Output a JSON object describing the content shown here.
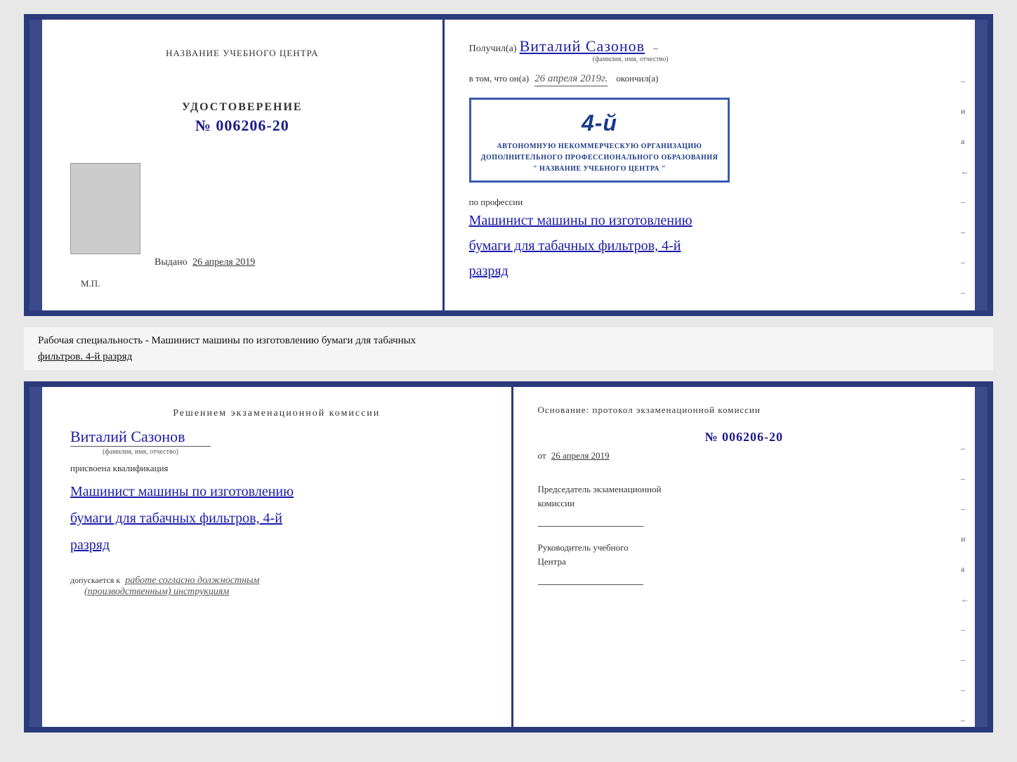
{
  "top_cert": {
    "left": {
      "org_name_label": "НАЗВАНИЕ УЧЕБНОГО ЦЕНТРА",
      "udost_label": "УДОСТОВЕРЕНИЕ",
      "udost_number": "№ 006206-20",
      "vydano_prefix": "Выдано",
      "vydano_date": "26 апреля 2019",
      "mp_label": "М.П."
    },
    "right": {
      "poluchil_prefix": "Получил(а)",
      "name_handwritten": "Виталий Сазонов",
      "name_subtext": "(фамилия, имя, отчество)",
      "dash1": "–",
      "vtom_prefix": "в том, что он(а)",
      "vtom_date": "26 апреля 2019г.",
      "okonchil_label": "окончил(а)",
      "stamp_number": "4-й",
      "stamp_line1": "АВТОНОМНУЮ НЕКОММЕРЧЕСКУЮ ОРГАНИЗАЦИЮ",
      "stamp_line2": "ДОПОЛНИТЕЛЬНОГО ПРОФЕССИОНАЛЬНОГО ОБРАЗОВАНИЯ",
      "stamp_line3": "\" НАЗВАНИЕ УЧЕБНОГО ЦЕНТРА \"",
      "i_label": "и",
      "a_label": "а",
      "arrow_label": "←",
      "po_professii_label": "по профессии",
      "profession_line1": "Машинист машины по изготовлению",
      "profession_line2": "бумаги для табачных фильтров, 4-й",
      "profession_line3": "разряд"
    }
  },
  "label_section": {
    "text_prefix": "Рабочая специальность - Машинист машины по изготовлению бумаги для табачных",
    "text_underlined": "фильтров. 4-й разряд"
  },
  "bottom_cert": {
    "left": {
      "resheniem_label": "Решением  экзаменационной  комиссии",
      "name_handwritten": "Виталий Сазонов",
      "fio_subtext": "(фамилия, имя, отчество)",
      "prisvoena_label": "присвоена квалификация",
      "kvalif_line1": "Машинист машины по изготовлению",
      "kvalif_line2": "бумаги для табачных фильтров, 4-й",
      "kvalif_line3": "разряд",
      "dopuskaetsya_prefix": "допускается к",
      "dopusk_text": "работе согласно должностным",
      "dopusk_text2": "(производственным) инструкциям"
    },
    "right": {
      "osnovanie_label": "Основание:  протокол  экзаменационной  комиссии",
      "protocol_number": "№  006206-20",
      "ot_prefix": "от",
      "ot_date": "26 апреля 2019",
      "predsedatel_label": "Председатель экзаменационной",
      "predsedatel_label2": "комиссии",
      "rukovoditel_label": "Руководитель учебного",
      "rukovoditel_label2": "Центра",
      "i_label": "и",
      "a_label": "а",
      "arrow_label": "←"
    }
  }
}
